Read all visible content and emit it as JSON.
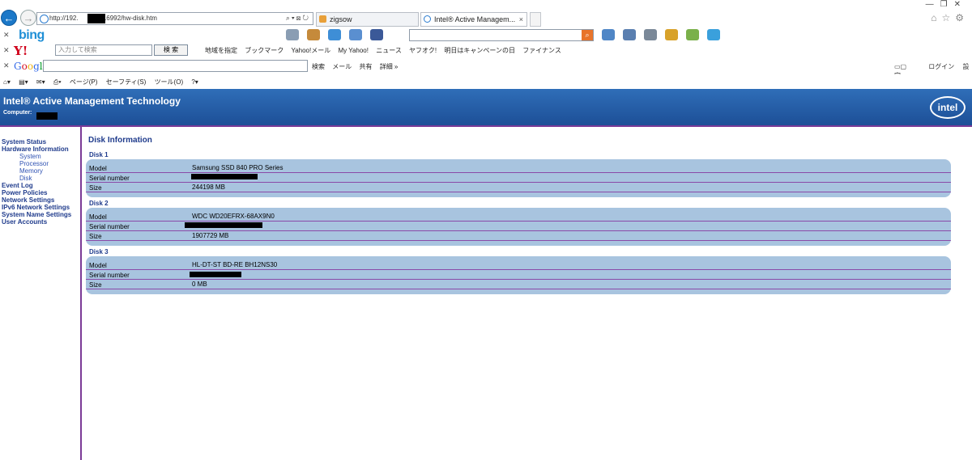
{
  "browser": {
    "url_visible_start": "http://192.",
    "url_visible_end": ":16992/hw-disk.htm",
    "tabs": [
      {
        "label": "zigsow"
      },
      {
        "label": "Intel® Active Managem..."
      }
    ]
  },
  "bing": {
    "logo": "bing"
  },
  "yahoo": {
    "logo": "Y!",
    "search_placeholder": "入力して検索",
    "search_button": "検 索",
    "links": [
      "地域を指定",
      "ブックマーク",
      "Yahoo!メール",
      "My Yahoo!",
      "ニュース",
      "ヤフオク!",
      "明日はキャンペーンの日",
      "ファイナンス"
    ]
  },
  "google": {
    "logo": "Google",
    "links": [
      "検索",
      "メール",
      "共有",
      "詳細 »"
    ],
    "login": "ログイン",
    "settings": "設定"
  },
  "commandbar": {
    "page": "ページ(P)",
    "safety": "セーフティ(S)",
    "tools": "ツール(O)"
  },
  "amt": {
    "title": "Intel® Active Management Technology",
    "computer_label": "Computer:",
    "logo": "intel"
  },
  "nav": {
    "items": [
      {
        "label": "System Status",
        "sub": false
      },
      {
        "label": "Hardware Information",
        "sub": false
      },
      {
        "label": "System",
        "sub": true
      },
      {
        "label": "Processor",
        "sub": true
      },
      {
        "label": "Memory",
        "sub": true
      },
      {
        "label": "Disk",
        "sub": true
      },
      {
        "label": "Event Log",
        "sub": false
      },
      {
        "label": "Power Policies",
        "sub": false
      },
      {
        "label": "Network Settings",
        "sub": false
      },
      {
        "label": "IPv6 Network Settings",
        "sub": false
      },
      {
        "label": "System Name Settings",
        "sub": false
      },
      {
        "label": "User Accounts",
        "sub": false
      }
    ]
  },
  "page": {
    "title": "Disk Information",
    "disks": [
      {
        "label": "Disk 1",
        "model_key": "Model",
        "model": "Samsung SSD 840 PRO Series",
        "serial_key": "Serial number",
        "size_key": "Size",
        "size": "244198 MB"
      },
      {
        "label": "Disk 2",
        "model_key": "Model",
        "model": "WDC WD20EFRX-68AX9N0",
        "serial_key": "Serial number",
        "size_key": "Size",
        "size": "1907729 MB"
      },
      {
        "label": "Disk 3",
        "model_key": "Model",
        "model": "HL-DT-ST BD-RE BH12NS30",
        "serial_key": "Serial number",
        "size_key": "Size",
        "size": "0 MB"
      }
    ]
  }
}
